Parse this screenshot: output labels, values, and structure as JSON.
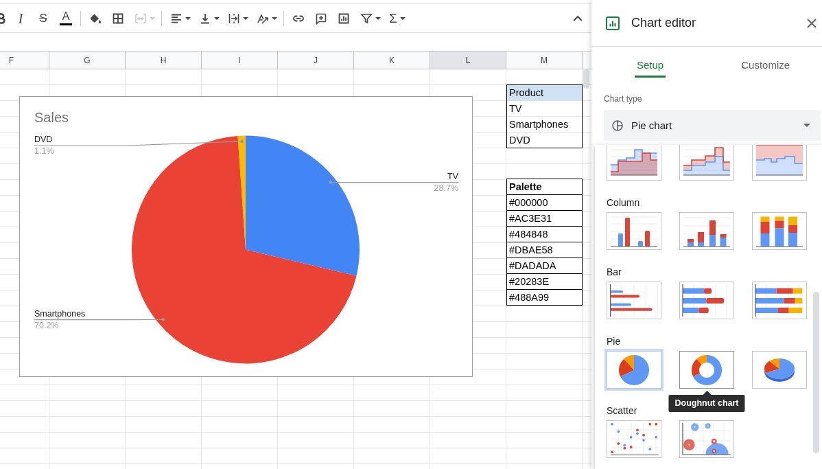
{
  "toolbar": {
    "groups": [
      [
        {
          "kind": "bold",
          "disabled": false,
          "menu": false
        },
        {
          "kind": "italic",
          "glyph": "I",
          "disabled": false,
          "menu": false
        },
        {
          "kind": "strikethrough",
          "glyph": "S",
          "disabled": false,
          "menu": false
        },
        {
          "kind": "text-color",
          "glyph": "A",
          "disabled": false,
          "menu": false
        }
      ],
      [
        {
          "kind": "fill-color",
          "disabled": false,
          "menu": false
        },
        {
          "kind": "borders",
          "disabled": false,
          "menu": false
        },
        {
          "kind": "merge",
          "disabled": true,
          "menu": true
        }
      ],
      [
        {
          "kind": "align",
          "disabled": false,
          "menu": true
        },
        {
          "kind": "vertical-align",
          "disabled": false,
          "menu": true
        },
        {
          "kind": "wrap",
          "disabled": false,
          "menu": true
        },
        {
          "kind": "rotate",
          "disabled": false,
          "menu": true
        }
      ],
      [
        {
          "kind": "link",
          "disabled": false,
          "menu": false
        },
        {
          "kind": "comment",
          "disabled": false,
          "menu": false
        },
        {
          "kind": "chart",
          "disabled": false,
          "menu": false
        },
        {
          "kind": "filter",
          "disabled": false,
          "menu": true
        },
        {
          "kind": "functions",
          "glyph": "Σ",
          "disabled": false,
          "menu": true
        }
      ]
    ]
  },
  "sheet": {
    "columns": [
      {
        "label": "F",
        "selected": false
      },
      {
        "label": "G",
        "selected": false
      },
      {
        "label": "H",
        "selected": false
      },
      {
        "label": "I",
        "selected": false
      },
      {
        "label": "J",
        "selected": false
      },
      {
        "label": "K",
        "selected": false
      },
      {
        "label": "L",
        "selected": true
      },
      {
        "label": "M",
        "selected": false
      }
    ],
    "product_table": {
      "header": "Product",
      "rows": [
        "TV",
        "Smartphones",
        "DVD"
      ]
    },
    "palette_table": {
      "header": "Palette",
      "rows": [
        "#000000",
        "#AC3E31",
        "#484848",
        "#DBAE58",
        "#DADADA",
        "#20283E",
        "#488A99"
      ]
    }
  },
  "chart": {
    "chart_data": {
      "type": "pie",
      "title": "Sales",
      "categories": [
        "TV",
        "Smartphones",
        "DVD"
      ],
      "values": [
        28.7,
        70.2,
        1.1
      ],
      "colors": [
        "#4285f4",
        "#ea4335",
        "#fbbc04"
      ],
      "data_labels": true,
      "value_labels": [
        "28.7%",
        "70.2%",
        "1.1%"
      ]
    }
  },
  "chart_editor": {
    "title": "Chart editor",
    "tabs": [
      {
        "label": "Setup",
        "selected": true
      },
      {
        "label": "Customize",
        "selected": false
      }
    ],
    "chart_type": {
      "label": "Chart type",
      "value": "Pie chart"
    },
    "chart_type_menu": {
      "sections": [
        {
          "options": [
            {
              "kind": "stepped-area",
              "selected": false
            },
            {
              "kind": "stacked-stepped-area",
              "selected": false
            },
            {
              "kind": "full-stacked-stepped-area",
              "selected": false
            }
          ]
        },
        {
          "label": "Column",
          "options": [
            {
              "kind": "column",
              "selected": false
            },
            {
              "kind": "stacked-column",
              "selected": false
            },
            {
              "kind": "full-stacked-column",
              "selected": false
            }
          ]
        },
        {
          "label": "Bar",
          "options": [
            {
              "kind": "bar",
              "selected": false
            },
            {
              "kind": "stacked-bar",
              "selected": false
            },
            {
              "kind": "full-stacked-bar",
              "selected": false
            }
          ]
        },
        {
          "label": "Pie",
          "options": [
            {
              "kind": "pie",
              "selected": true
            },
            {
              "kind": "doughnut",
              "selected": false,
              "tooltip": "Doughnut chart"
            },
            {
              "kind": "pie-3d",
              "selected": false
            }
          ]
        },
        {
          "label": "Scatter",
          "options": [
            {
              "kind": "scatter",
              "selected": false
            },
            {
              "kind": "bubble",
              "selected": false
            }
          ]
        }
      ]
    }
  }
}
